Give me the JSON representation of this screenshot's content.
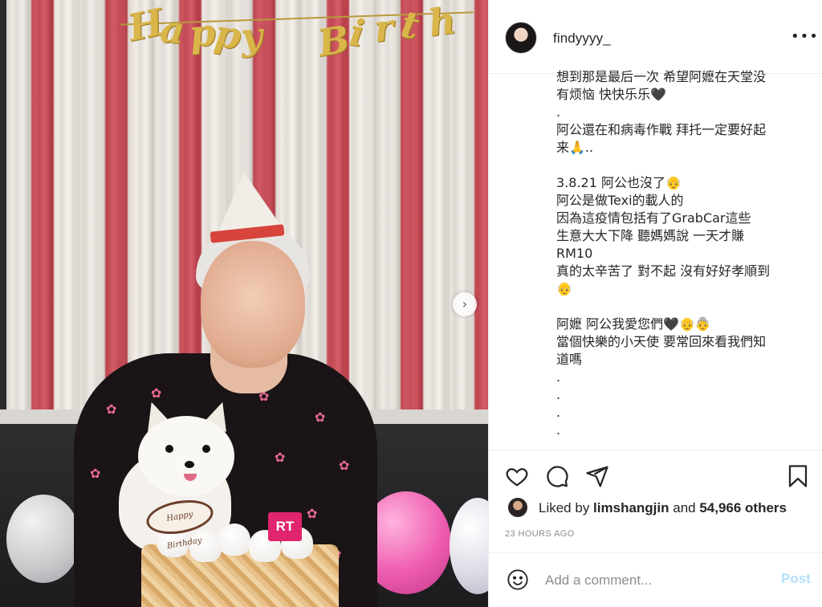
{
  "header": {
    "username": "findyyyy_",
    "more_label": "•••"
  },
  "photo": {
    "banner_letters": [
      "H",
      "a",
      "p",
      "p",
      "y",
      "B",
      "i",
      "r",
      "t",
      "h"
    ],
    "cake_plaque": "Happy Birthday",
    "cake_tag": "RT",
    "next_icon": "›"
  },
  "caption": {
    "lines": [
      "想到那是最后一次 希望阿嬷在天堂没",
      "有烦恼 快快乐乐🖤",
      ".",
      "阿公還在和病毒作戰 拜托一定要好起",
      "来🙏..",
      "",
      "3.8.21 阿公也沒了👴",
      "阿公是做Texi的載人的",
      "因為這疫情包括有了GrabCar這些",
      "生意大大下降 聽媽媽說 一天才賺",
      "RM10",
      "真的太辛苦了 對不起 沒有好好孝順到",
      "👴",
      "",
      "阿嬷 阿公我愛您們🖤👴👵",
      "當個快樂的小天使 要常回來看我們知",
      "道嗎",
      ".",
      ".",
      ".",
      "."
    ]
  },
  "likes": {
    "prefix": "Liked by ",
    "user": "limshangjin",
    "middle": " and ",
    "count": "54,966 others"
  },
  "timestamp": "23 HOURS AGO",
  "comment": {
    "placeholder": "Add a comment...",
    "post_label": "Post"
  },
  "colors": {
    "text": "#262626",
    "secondary": "#8e8e8e",
    "post_disabled": "#b2dffc",
    "divider": "#efefef"
  }
}
